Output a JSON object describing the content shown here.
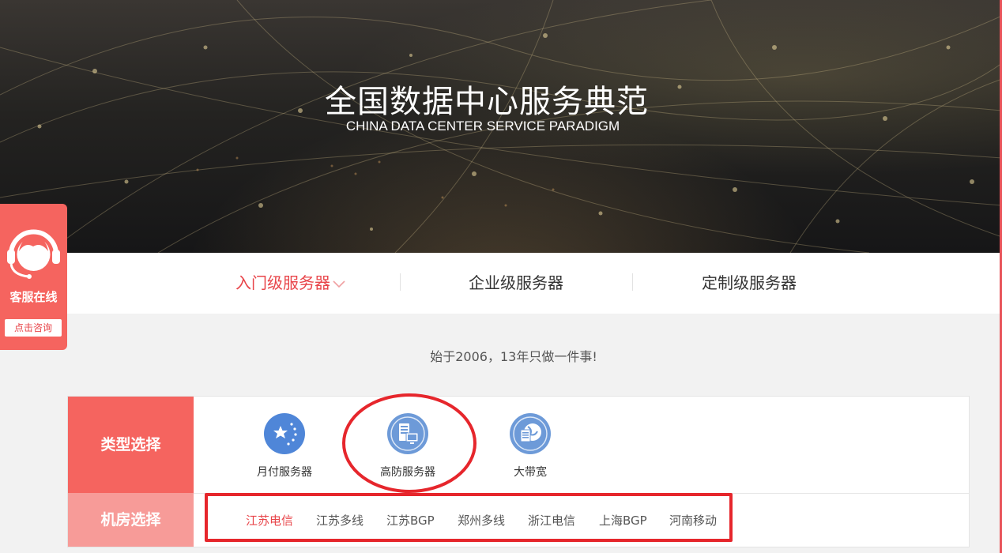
{
  "hero": {
    "title": "全国数据中心服务典范",
    "subtitle": "CHINA DATA CENTER SERVICE PARADIGM"
  },
  "tabs": [
    {
      "label": "入门级服务器",
      "active": true
    },
    {
      "label": "企业级服务器",
      "active": false
    },
    {
      "label": "定制级服务器",
      "active": false
    }
  ],
  "slogan": "始于2006，13年只做一件事!",
  "type_select": {
    "label": "类型选择",
    "items": [
      {
        "label": "月付服务器",
        "icon": "star-globe-icon"
      },
      {
        "label": "高防服务器",
        "icon": "server-monitor-icon"
      },
      {
        "label": "大带宽",
        "icon": "globe-document-icon"
      }
    ]
  },
  "room_select": {
    "label": "机房选择",
    "items": [
      "江苏电信",
      "江苏多线",
      "江苏BGP",
      "郑州多线",
      "浙江电信",
      "上海BGP",
      "河南移动"
    ],
    "active_index": 0
  },
  "customer_service": {
    "label": "客服在线",
    "button": "点击咨询",
    "icon": "headset-agent-icon"
  },
  "colors": {
    "accent": "#e8454a",
    "panel_row1": "#f5645f",
    "panel_row2": "#f79b98",
    "annotation": "#e6262c"
  }
}
